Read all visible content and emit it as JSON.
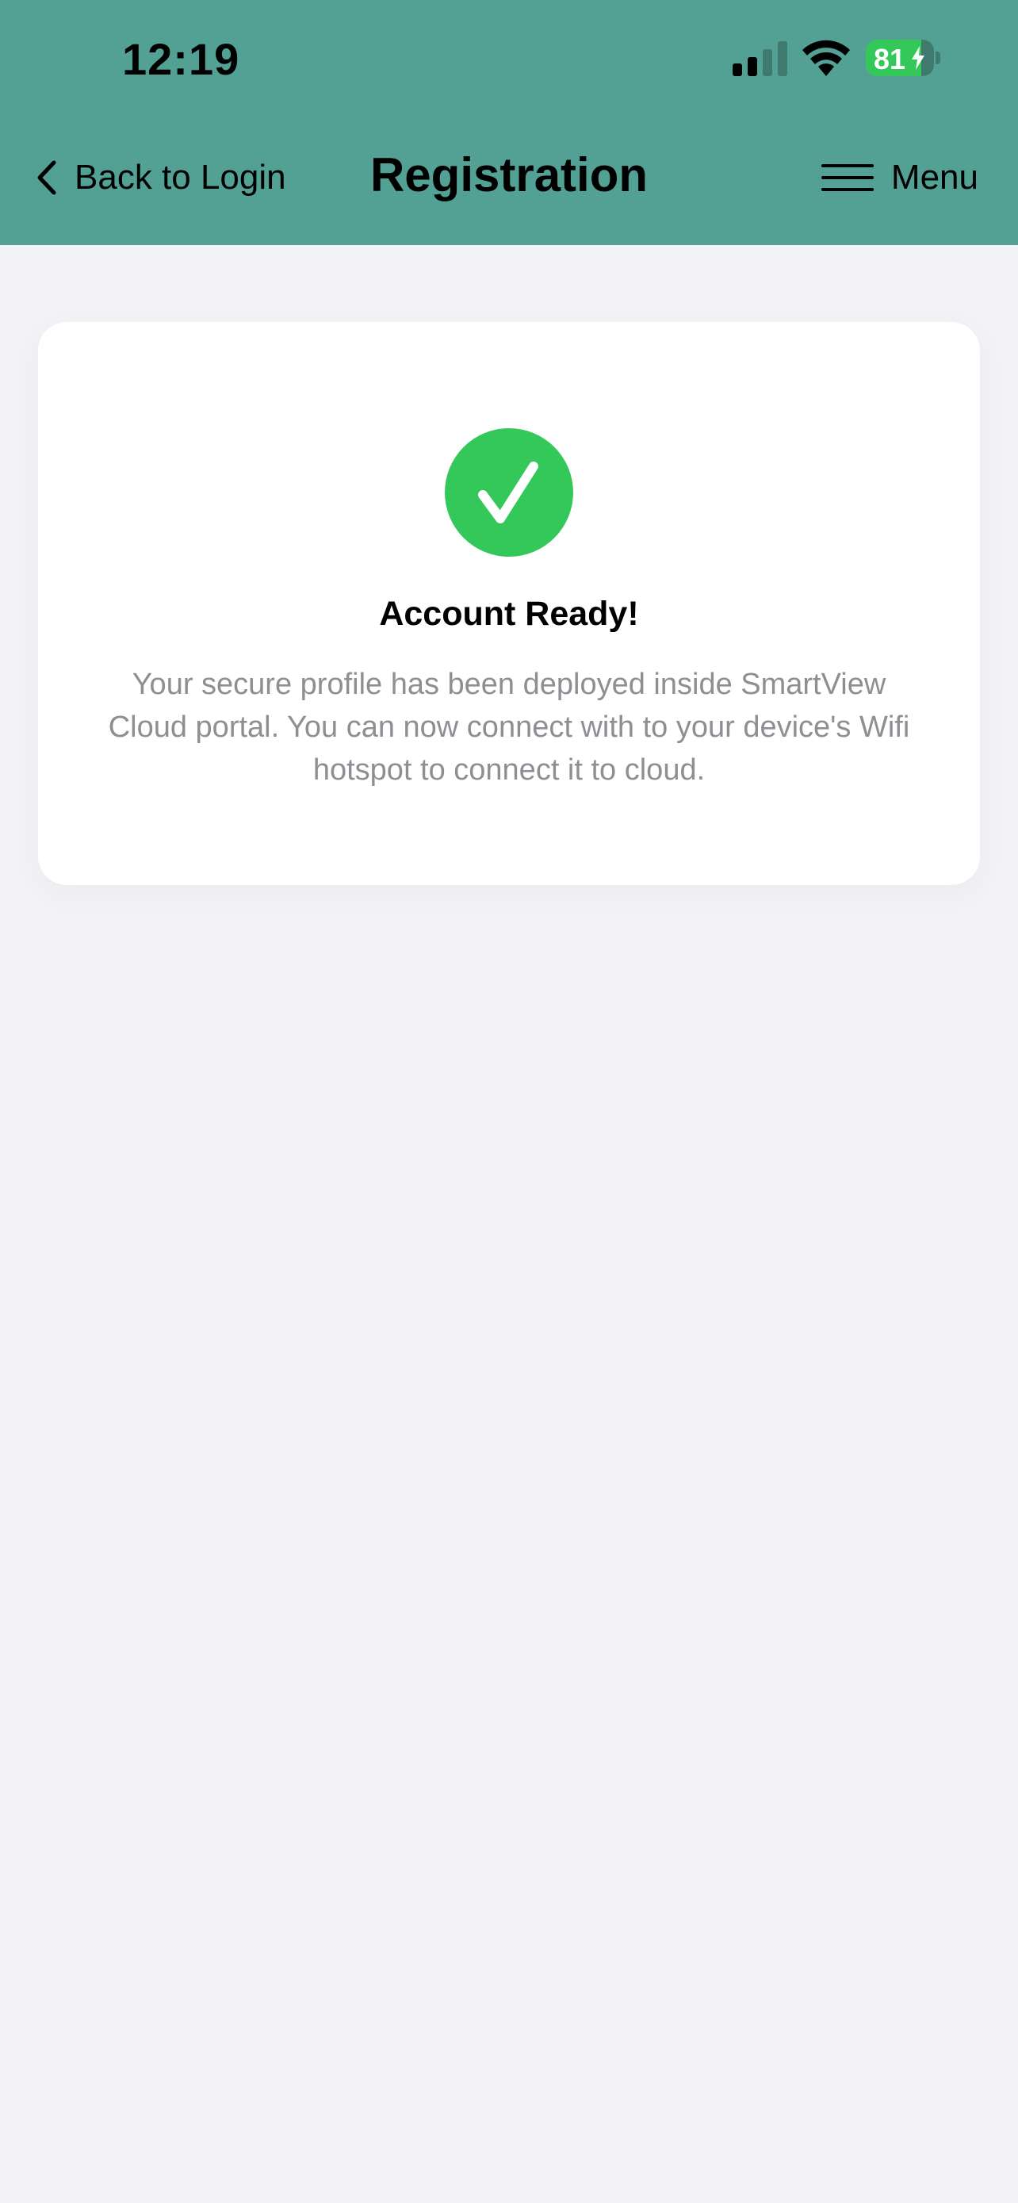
{
  "status_bar": {
    "time": "12:19",
    "battery_level": "81",
    "signal_icon": "cellular-signal-icon",
    "wifi_icon": "wifi-icon",
    "battery_icon": "battery-charging-icon"
  },
  "nav": {
    "back_label": "Back to Login",
    "back_icon": "chevron-left-icon",
    "title": "Registration",
    "menu_label": "Menu",
    "menu_icon": "hamburger-menu-icon"
  },
  "card": {
    "icon": "checkmark-circle-icon",
    "title": "Account Ready!",
    "body": "Your secure profile has been deployed inside SmartView Cloud portal. You can now connect with to your device's Wifi hotspot to connect it to cloud."
  },
  "colors": {
    "header": "#53a195",
    "background": "#f2f2f7",
    "card": "#ffffff",
    "success": "#34c759",
    "secondary_text": "#8e8e93"
  }
}
